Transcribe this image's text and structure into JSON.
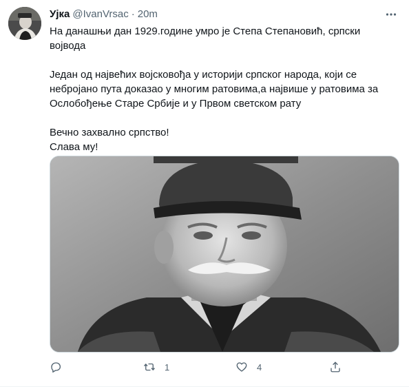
{
  "tweet": {
    "display_name": "Ујка",
    "handle": "@IvanVrsac",
    "separator": "·",
    "time": "20m",
    "text": "На данашњи дан 1929.године умро је Степа Степановић, српски војвода\n\nЈедан од највећих војсковођа у историји српског народа, који се небројано пута доказао у многим ратовима,а највише у ратовима за Ослобођење Старе Србије и у Првом светском рату\n\nВечно захвално српство!\nСлава му!",
    "media": {
      "description_icon": "photo-portrait"
    }
  },
  "actions": {
    "reply": {
      "icon": "reply-icon",
      "count": ""
    },
    "retweet": {
      "icon": "retweet-icon",
      "count": "1"
    },
    "like": {
      "icon": "heart-icon",
      "count": "4"
    },
    "share": {
      "icon": "share-icon",
      "count": ""
    }
  },
  "colors": {
    "text": "#0f1419",
    "secondary": "#536471",
    "border": "#cfd9de"
  }
}
